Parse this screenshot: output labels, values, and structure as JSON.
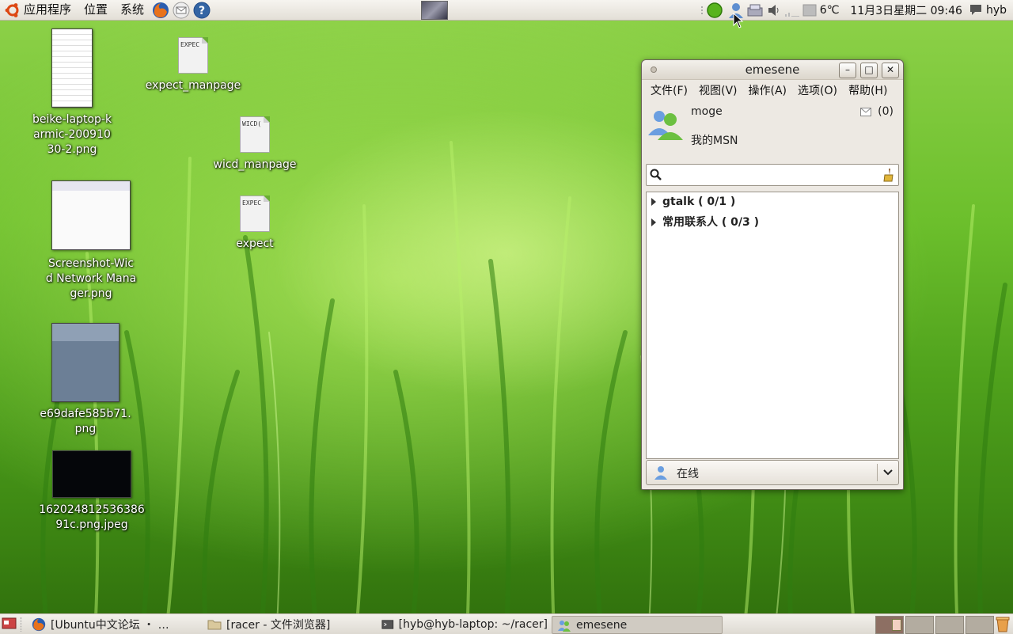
{
  "top_panel": {
    "menus": [
      "应用程序",
      "位置",
      "系统"
    ],
    "weather": "6℃",
    "datetime": "11月3日星期二 09:46",
    "user": "hyb"
  },
  "desktop": {
    "icons": [
      {
        "label": "beike-laptop-karmic-20091030-2.png"
      },
      {
        "label": "expect_manpage",
        "filetype": "EXPEC"
      },
      {
        "label": "wicd_manpage",
        "filetype": "WICD("
      },
      {
        "label": "expect",
        "filetype": "EXPEC"
      },
      {
        "label": "Screenshot-Wicd Network Manager.png"
      },
      {
        "label": "e69dafe585b71.png"
      },
      {
        "label": "16202481253638691c.png.jpeg"
      }
    ]
  },
  "emesene": {
    "title": "emesene",
    "menu": [
      "文件(F)",
      "视图(V)",
      "操作(A)",
      "选项(O)",
      "帮助(H)"
    ],
    "username": "moge",
    "personal_message": "我的MSN",
    "mail_count": "(0)",
    "search_placeholder": "",
    "groups": [
      {
        "name": "gtalk ( 0/1 )"
      },
      {
        "name": "常用联系人 ( 0/3 )"
      }
    ],
    "status": "在线"
  },
  "taskbar": {
    "tasks": [
      {
        "label": "[Ubuntu中文论坛 ・ …"
      },
      {
        "label": "[racer - 文件浏览器]"
      },
      {
        "label": "[hyb@hyb-laptop: ~/racer]"
      },
      {
        "label": "emesene"
      }
    ]
  },
  "colors": {
    "accent_green": "#4fa11c",
    "panel": "#ebe8e2"
  }
}
